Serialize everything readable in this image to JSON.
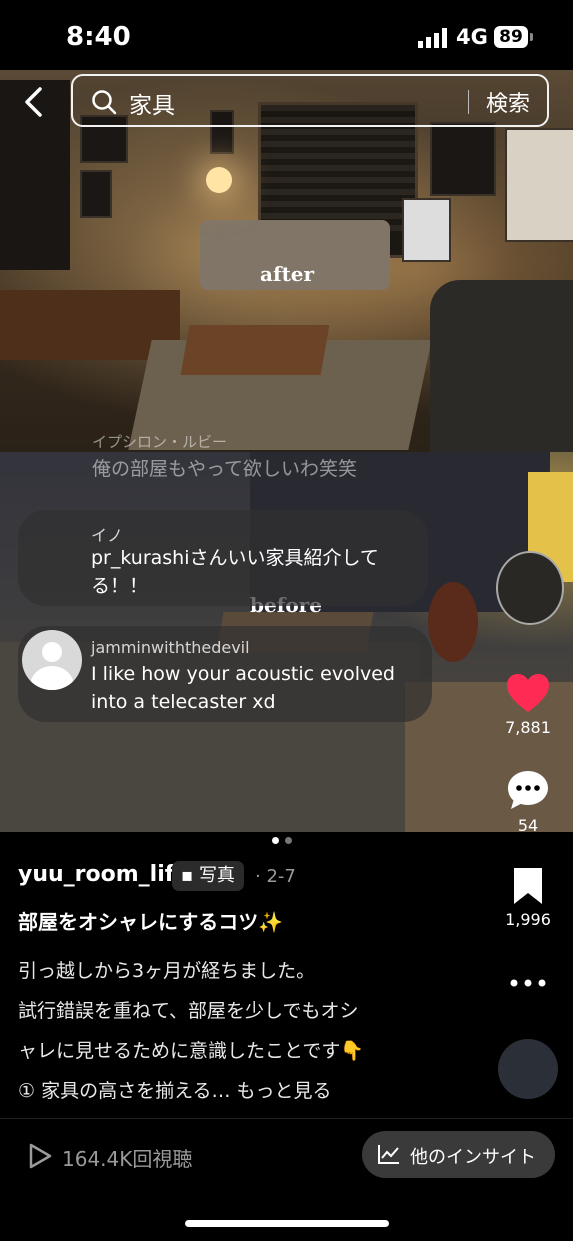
{
  "status": {
    "time": "8:40",
    "network": "4G",
    "battery": "89"
  },
  "search": {
    "query": "家具",
    "button": "検索"
  },
  "photo": {
    "after_label": "after",
    "before_label": "before"
  },
  "comments": [
    {
      "name": "イプシロン・ルビー",
      "text": "俺の部屋もやって欲しいわ笑笑"
    },
    {
      "name": "イノ",
      "line1": "pr_kurashiさんいい家具紹介して",
      "line2": "る！！"
    },
    {
      "name": "jamminwiththedevil",
      "line1": "I like how your acoustic evolved",
      "line2": "into a telecaster xd"
    }
  ],
  "actions": {
    "likes": "7,881",
    "comments": "54",
    "saves": "1,996"
  },
  "post": {
    "username": "yuu_room_life",
    "type_tag": "写真",
    "date": "· 2-7",
    "title": "部屋をオシャレにするコツ✨",
    "desc_lines": [
      "引っ越しから3ヶ月が経ちました。",
      "試行錯誤を重ねて、部屋を少しでもオシ",
      "ャレに見せるために意識したことです👇",
      "① 家具の高さを揃える… もっと見る"
    ]
  },
  "bottom": {
    "views": "164.4K回視聴",
    "insight": "他のインサイト"
  },
  "colors": {
    "like": "#ff2b55",
    "background": "#000000"
  }
}
